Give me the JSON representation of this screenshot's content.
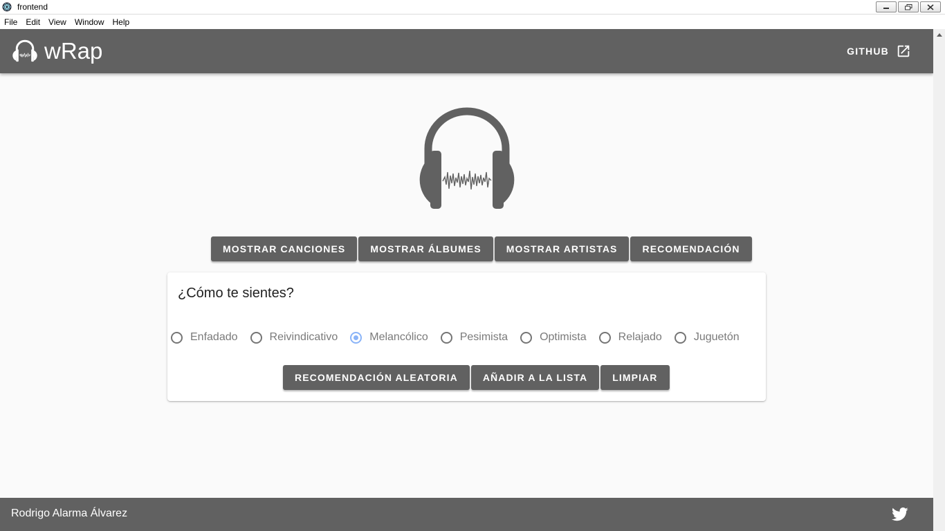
{
  "window": {
    "title": "frontend",
    "menu": [
      "File",
      "Edit",
      "View",
      "Window",
      "Help"
    ]
  },
  "appbar": {
    "brand": "wRap",
    "github_label": "GITHUB"
  },
  "tabs": [
    {
      "label": "MOSTRAR CANCIONES"
    },
    {
      "label": "MOSTRAR ÁLBUMES"
    },
    {
      "label": "MOSTRAR ARTISTAS"
    },
    {
      "label": "RECOMENDACIÓN"
    }
  ],
  "card": {
    "title": "¿Cómo te sientes?",
    "moods": [
      {
        "label": "Enfadado",
        "checked": false
      },
      {
        "label": "Reivindicativo",
        "checked": false
      },
      {
        "label": "Melancólico",
        "checked": true
      },
      {
        "label": "Pesimista",
        "checked": false
      },
      {
        "label": "Optimista",
        "checked": false
      },
      {
        "label": "Relajado",
        "checked": false
      },
      {
        "label": "Juguetón",
        "checked": false
      }
    ],
    "actions": [
      {
        "label": "RECOMENDACIÓN ALEATORIA"
      },
      {
        "label": "AÑADIR A LA LISTA"
      },
      {
        "label": "LIMPIAR"
      }
    ]
  },
  "footer": {
    "author": "Rodrigo Alarma Álvarez"
  },
  "icons": {
    "logo": "headphones-icon",
    "external_link": "open-in-new-icon",
    "social": "twitter-icon"
  },
  "colors": {
    "primary": "#616161",
    "background": "#fafafa",
    "radio_checked": "#8ab4f8",
    "radio_unchecked": "#757575",
    "mood_text": "#7a7a7a"
  }
}
